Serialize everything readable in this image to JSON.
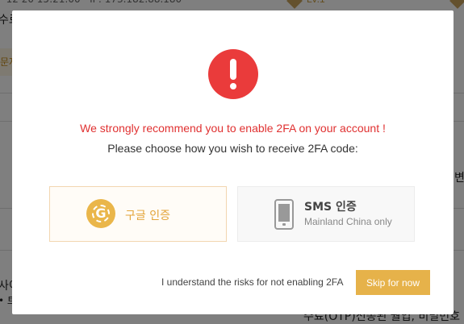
{
  "modal": {
    "warning": "We strongly recommend you to enable 2FA on your account !",
    "instruction": "Please choose how you wish to receive 2FA code:",
    "google_option": {
      "icon": "google-authenticator-icon",
      "label": "구글 인증"
    },
    "sms_option": {
      "icon": "mobile-phone-icon",
      "title": "SMS 인증",
      "subtitle": "Mainland China only"
    },
    "risk_text": "I understand the risks for not enabling 2FA",
    "skip_label": "Skip for now"
  },
  "colors": {
    "alert": "#ea3b3b",
    "warning_text": "#e03131",
    "accent": "#e6b24a",
    "google_text": "#e3a53b"
  }
}
